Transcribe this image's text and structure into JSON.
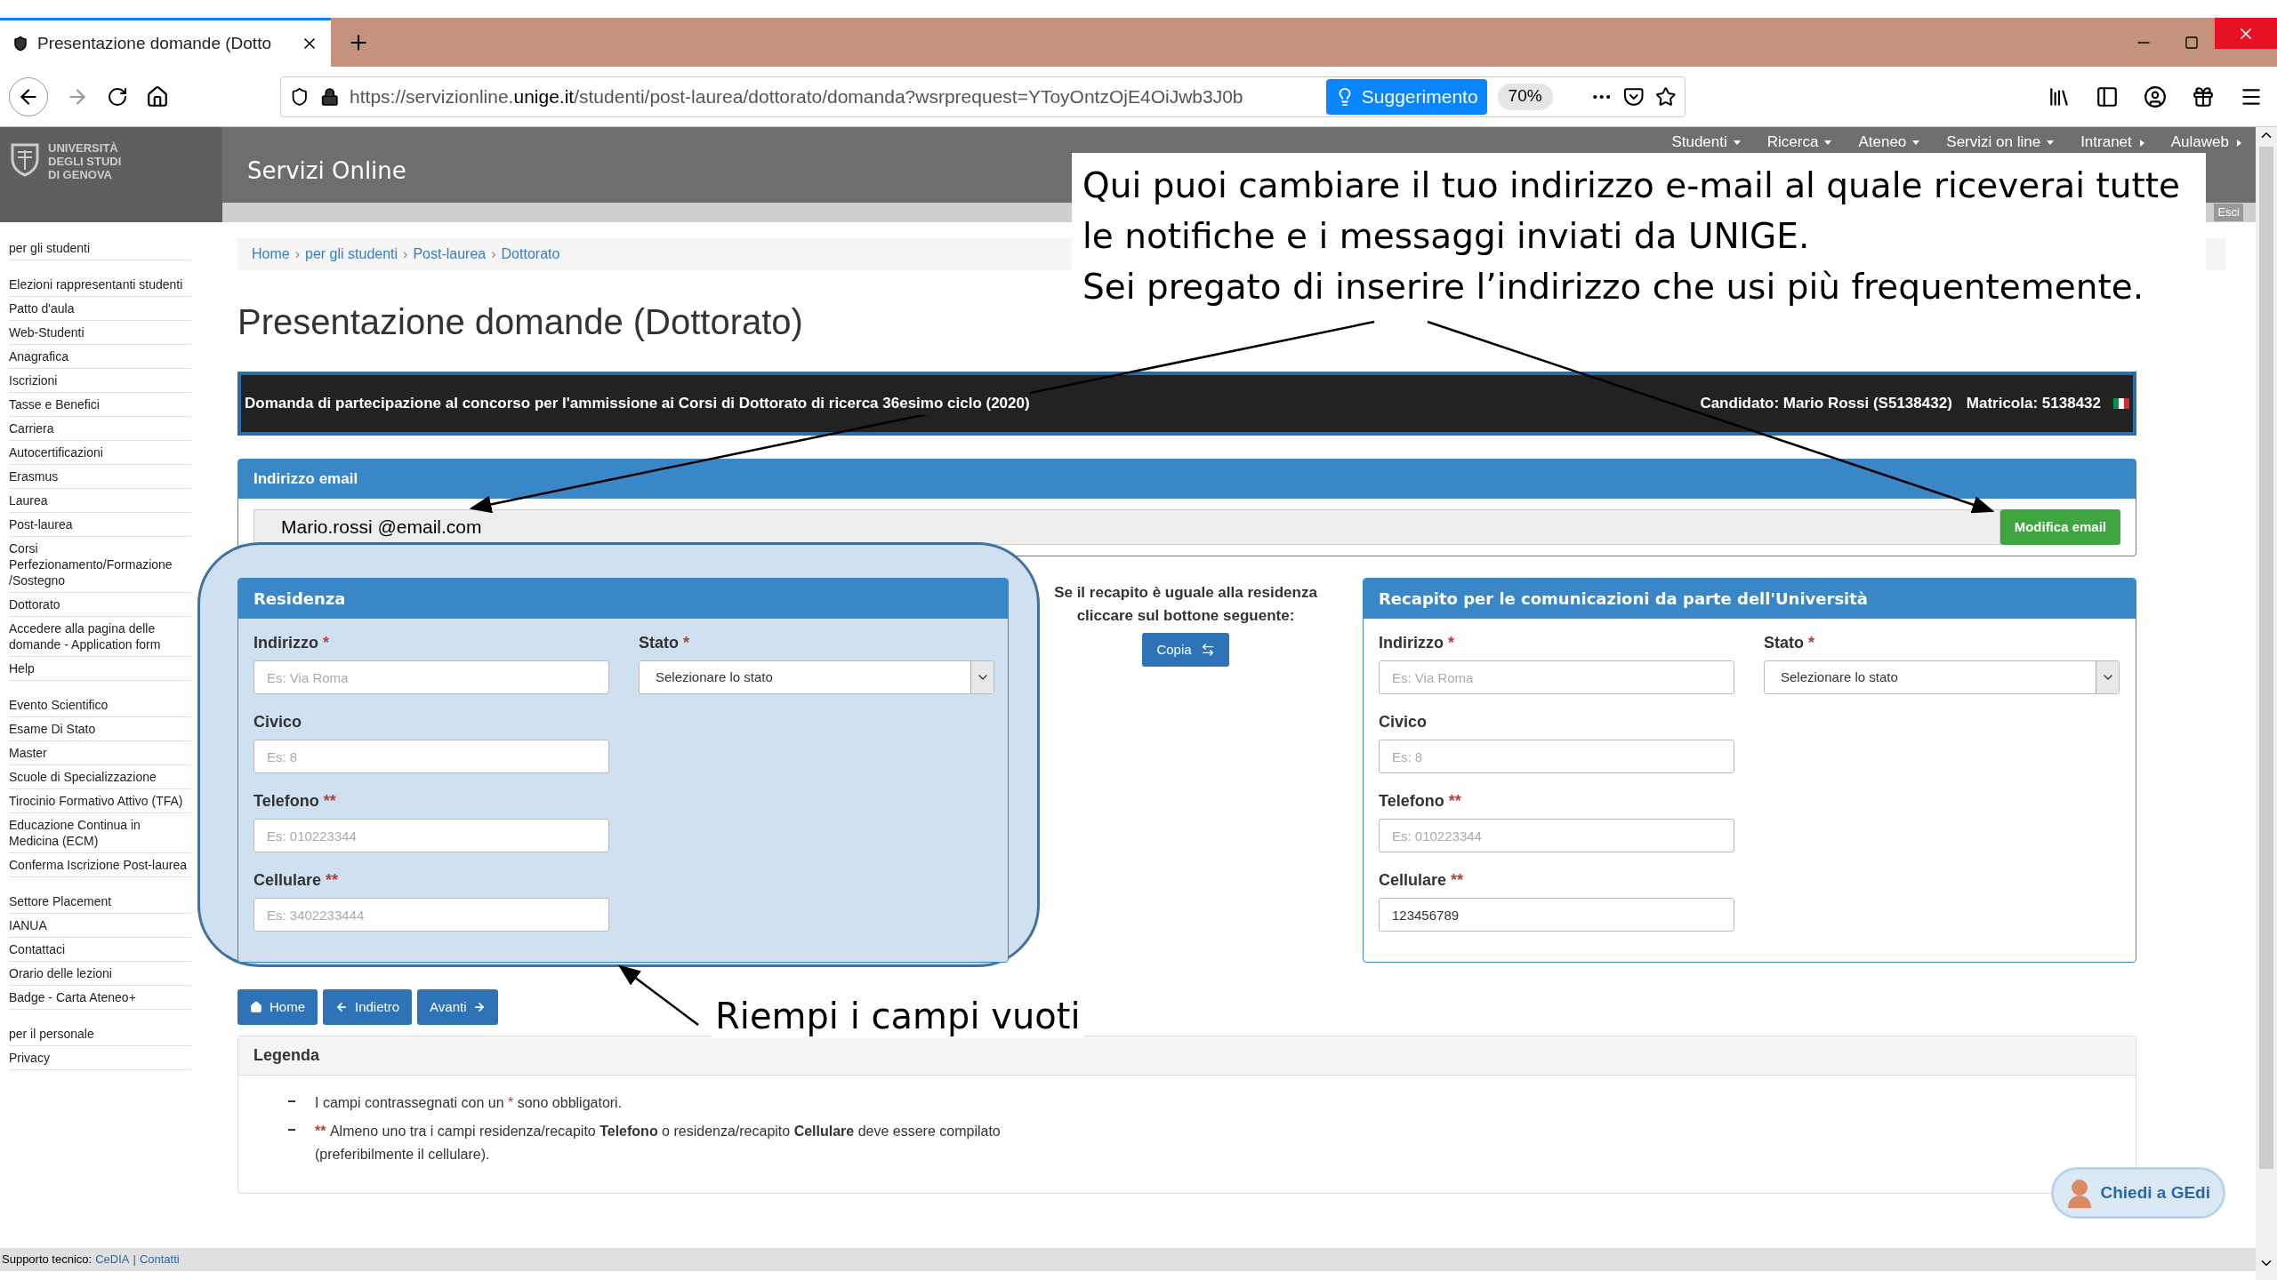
{
  "browser": {
    "tab_title": "Presentazione domande (Dotto",
    "url_prefix": "https://servizionline.",
    "url_domain": "unige.it",
    "url_rest": "/studenti/post-laurea/dottorato/domanda?wsrprequest=YToyOntzOjE4OiJwb3J0b",
    "suggestion": "Suggerimento",
    "zoom": "70%"
  },
  "header": {
    "logo_lines": [
      "UNIVERSITÀ",
      "DEGLI STUDI",
      "DI GENOVA"
    ],
    "site_title": "Servizi Online",
    "logout": "Esci",
    "nav": [
      {
        "label": "Studenti",
        "kind": "dropdown"
      },
      {
        "label": "Ricerca",
        "kind": "dropdown"
      },
      {
        "label": "Ateneo",
        "kind": "dropdown"
      },
      {
        "label": "Servizi on line",
        "kind": "dropdown"
      },
      {
        "label": "Intranet",
        "kind": "submenu"
      },
      {
        "label": "Aulaweb",
        "kind": "submenu"
      }
    ]
  },
  "sidebar": {
    "sections": [
      [
        "per gli studenti"
      ],
      [
        "Elezioni rappresentanti studenti",
        "Patto d'aula",
        "Web-Studenti",
        "Anagrafica",
        "Iscrizioni",
        "Tasse e Benefici",
        "Carriera",
        "Autocertificazioni",
        "Erasmus",
        "Laurea",
        "Post-laurea",
        "Corsi Perfezionamento/Formazione /Sostegno",
        "Dottorato",
        "Accedere alla pagina delle domande - Application form",
        "Help"
      ],
      [
        "Evento Scientifico",
        "Esame Di Stato",
        "Master",
        "Scuole di Specializzazione",
        "Tirocinio Formativo Attivo (TFA)",
        "Educazione Continua in Medicina (ECM)",
        "Conferma Iscrizione Post-laurea"
      ],
      [
        "Settore Placement",
        "IANUA",
        "Contattaci",
        "Orario delle lezioni",
        "Badge - Carta Ateneo+"
      ],
      [
        "per il personale",
        "Privacy"
      ]
    ]
  },
  "breadcrumb": {
    "separator": "›",
    "items": [
      "Home",
      "per gli studenti",
      "Post-laurea",
      "Dottorato"
    ]
  },
  "page_title": "Presentazione domande (Dottorato)",
  "banner": {
    "description": "Domanda di partecipazione al concorso per l'ammissione ai Corsi di Dottorato di ricerca 36esimo ciclo (2020)",
    "candidate": "Candidato: Mario Rossi (S5138432)",
    "matricola": "Matricola: 5138432"
  },
  "email_panel": {
    "title": "Indirizzo email",
    "value": "Mario.rossi @email.com",
    "button": "Modifica email"
  },
  "residenza": {
    "title": "Residenza",
    "highlighted": true,
    "fields": [
      {
        "kind": "text",
        "label": "Indirizzo",
        "required": "*",
        "placeholder": "Es: Via Roma"
      },
      {
        "kind": "select",
        "label": "Stato",
        "required": "*",
        "value": "Selezionare lo stato"
      },
      {
        "kind": "text",
        "label": "Civico",
        "placeholder": "Es: 8"
      },
      {
        "kind": "text",
        "label": "Telefono",
        "required": "**",
        "placeholder": "Es: 010223344"
      },
      {
        "kind": "text",
        "label": "Cellulare",
        "required": "**",
        "placeholder": "Es: 3402233444"
      }
    ]
  },
  "copy_hint": {
    "text": "Se il recapito è uguale alla residenza cliccare sul bottone seguente:",
    "button": "Copia"
  },
  "recapito": {
    "title": "Recapito per le comunicazioni da parte dell'Università",
    "highlighted": false,
    "fields": [
      {
        "kind": "text",
        "label": "Indirizzo",
        "required": "*",
        "placeholder": "Es: Via Roma"
      },
      {
        "kind": "select",
        "label": "Stato",
        "required": "*",
        "value": "Selezionare lo stato"
      },
      {
        "kind": "text",
        "label": "Civico",
        "placeholder": "Es: 8"
      },
      {
        "kind": "text",
        "label": "Telefono",
        "required": "**",
        "placeholder": "Es: 010223344"
      },
      {
        "kind": "text",
        "label": "Cellulare",
        "required": "**",
        "value": "123456789"
      }
    ]
  },
  "nav_buttons": [
    {
      "kind": "home",
      "label": "Home"
    },
    {
      "kind": "back",
      "label": "Indietro"
    },
    {
      "kind": "forward",
      "label": "Avanti"
    }
  ],
  "legend": {
    "title": "Legenda",
    "items": [
      {
        "mark": "*",
        "text_before": "I campi contrassegnati con un ",
        "text_after": " sono obbligatori.",
        "kind": "inline"
      },
      {
        "mark": "**",
        "text_before": "Almeno uno tra i campi residenza/recapito **Telefono** o residenza/recapito **Cellulare** deve essere compilato (preferibilmente il cellulare).",
        "kind": "leading"
      }
    ]
  },
  "footer": {
    "label": "Supporto tecnico:",
    "links": [
      "CeDIA",
      "Contatti"
    ],
    "separator": "|"
  },
  "chat_button": "Chiedi a GEdi",
  "annotations": {
    "callout": [
      "Qui puoi cambiare il tuo indirizzo e-mail al quale riceverai tutte le notifiche e i messaggi inviati da UNIGE.",
      "Sei pregato di inserire l’indirizzo che usi più frequentemente."
    ],
    "hint": "Riempi i campi vuoti"
  }
}
